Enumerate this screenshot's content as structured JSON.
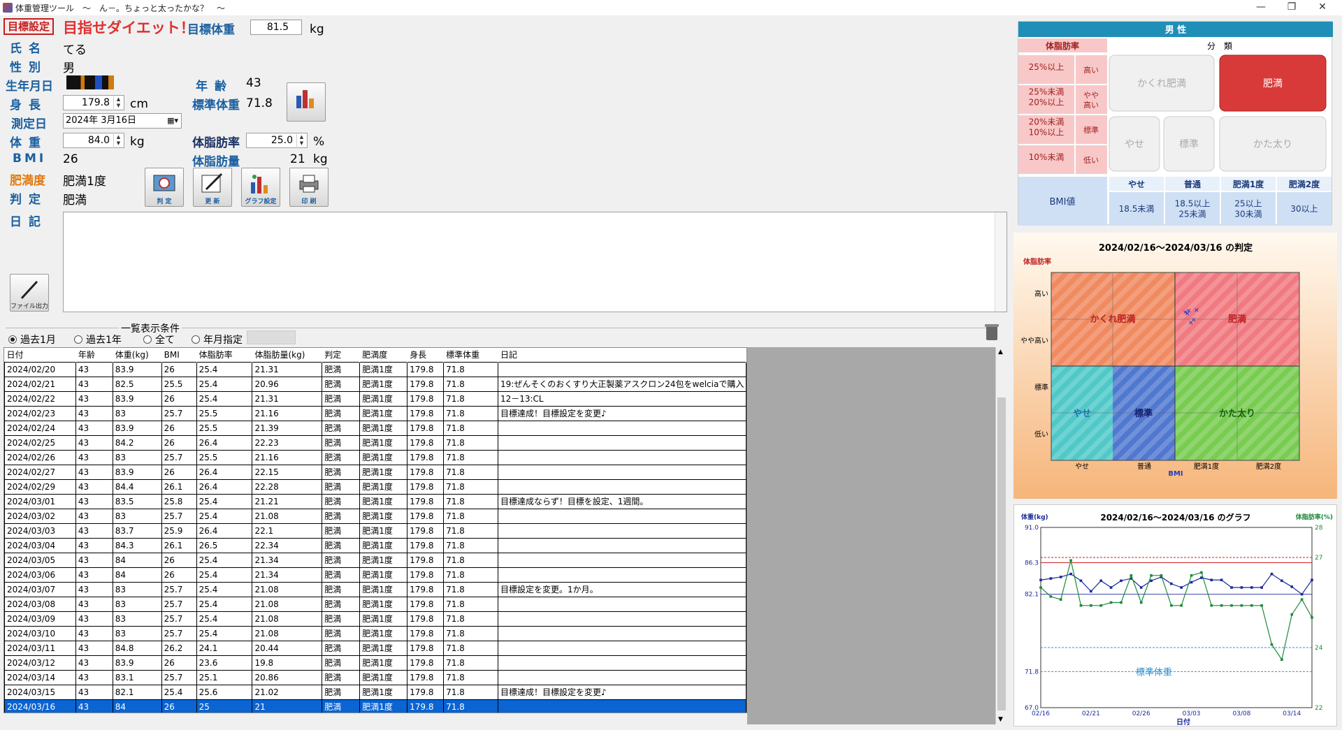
{
  "window": {
    "title": "体重管理ツール　～　ん－。ちょっと太ったかな？　～",
    "min": "—",
    "max": "❐",
    "close": "✕"
  },
  "header": {
    "goal_button": "目標設定",
    "slogan": "目指せダイエット！",
    "goal_weight_label": "目標体重",
    "goal_weight_value": "81.5",
    "goal_weight_unit": "kg"
  },
  "profile": {
    "name_label": "氏名",
    "name_value": "てる",
    "sex_label": "性別",
    "sex_value": "男",
    "birth_label": "生年月日",
    "age_label": "年齢",
    "age_value": "43",
    "height_label": "身長",
    "height_value": "179.8",
    "height_unit": "cm",
    "std_weight_label": "標準体重",
    "std_weight_value": "71.8",
    "date_label": "測定日",
    "date_value": "2024年 3月16日",
    "weight_label": "体重",
    "weight_value": "84.0",
    "weight_unit": "kg",
    "fat_rate_label": "体脂肪率",
    "fat_rate_value": "25.0",
    "fat_rate_unit": "%",
    "bmi_label": "BMI",
    "bmi_value": "26",
    "fat_mass_label": "体脂肪量",
    "fat_mass_value": "21",
    "fat_mass_unit": "kg",
    "obesity_label": "肥満度",
    "obesity_value": "肥満1度",
    "judge_label": "判定",
    "judge_value": "肥満",
    "diary_label": "日記"
  },
  "buttons": {
    "judge": "判 定",
    "update": "更 新",
    "graph_setting": "グラフ設定",
    "print": "印 刷",
    "file_output": "ファイル出力"
  },
  "list_condition": {
    "title": "一覧表示条件",
    "options": [
      "過去1月",
      "過去1年",
      "全て",
      "年月指定"
    ],
    "selected": 0
  },
  "table": {
    "headers": [
      "日付",
      "年齢",
      "体重(kg)",
      "BMI",
      "体脂肪率",
      "体脂肪量(kg)",
      "判定",
      "肥満度",
      "身長",
      "標準体重",
      "日記"
    ],
    "rows": [
      [
        "2024/02/20",
        "43",
        "83.9",
        "26",
        "25.4",
        "21.31",
        "肥満",
        "肥満1度",
        "179.8",
        "71.8",
        ""
      ],
      [
        "2024/02/21",
        "43",
        "82.5",
        "25.5",
        "25.4",
        "20.96",
        "肥満",
        "肥満1度",
        "179.8",
        "71.8",
        "19:ぜんそくのおくすり大正製薬アスクロン24包をwelciaで購入"
      ],
      [
        "2024/02/22",
        "43",
        "83.9",
        "26",
        "25.4",
        "21.31",
        "肥満",
        "肥満1度",
        "179.8",
        "71.8",
        "12－13:CL"
      ],
      [
        "2024/02/23",
        "43",
        "83",
        "25.7",
        "25.5",
        "21.16",
        "肥満",
        "肥満1度",
        "179.8",
        "71.8",
        "目標達成！目標設定を変更♪"
      ],
      [
        "2024/02/24",
        "43",
        "83.9",
        "26",
        "25.5",
        "21.39",
        "肥満",
        "肥満1度",
        "179.8",
        "71.8",
        ""
      ],
      [
        "2024/02/25",
        "43",
        "84.2",
        "26",
        "26.4",
        "22.23",
        "肥満",
        "肥満1度",
        "179.8",
        "71.8",
        ""
      ],
      [
        "2024/02/26",
        "43",
        "83",
        "25.7",
        "25.5",
        "21.16",
        "肥満",
        "肥満1度",
        "179.8",
        "71.8",
        ""
      ],
      [
        "2024/02/27",
        "43",
        "83.9",
        "26",
        "26.4",
        "22.15",
        "肥満",
        "肥満1度",
        "179.8",
        "71.8",
        ""
      ],
      [
        "2024/02/29",
        "43",
        "84.4",
        "26.1",
        "26.4",
        "22.28",
        "肥満",
        "肥満1度",
        "179.8",
        "71.8",
        ""
      ],
      [
        "2024/03/01",
        "43",
        "83.5",
        "25.8",
        "25.4",
        "21.21",
        "肥満",
        "肥満1度",
        "179.8",
        "71.8",
        "目標達成ならず！目標を設定、1週間。"
      ],
      [
        "2024/03/02",
        "43",
        "83",
        "25.7",
        "25.4",
        "21.08",
        "肥満",
        "肥満1度",
        "179.8",
        "71.8",
        ""
      ],
      [
        "2024/03/03",
        "43",
        "83.7",
        "25.9",
        "26.4",
        "22.1",
        "肥満",
        "肥満1度",
        "179.8",
        "71.8",
        ""
      ],
      [
        "2024/03/04",
        "43",
        "84.3",
        "26.1",
        "26.5",
        "22.34",
        "肥満",
        "肥満1度",
        "179.8",
        "71.8",
        ""
      ],
      [
        "2024/03/05",
        "43",
        "84",
        "26",
        "25.4",
        "21.34",
        "肥満",
        "肥満1度",
        "179.8",
        "71.8",
        ""
      ],
      [
        "2024/03/06",
        "43",
        "84",
        "26",
        "25.4",
        "21.34",
        "肥満",
        "肥満1度",
        "179.8",
        "71.8",
        ""
      ],
      [
        "2024/03/07",
        "43",
        "83",
        "25.7",
        "25.4",
        "21.08",
        "肥満",
        "肥満1度",
        "179.8",
        "71.8",
        "目標設定を変更。1か月。"
      ],
      [
        "2024/03/08",
        "43",
        "83",
        "25.7",
        "25.4",
        "21.08",
        "肥満",
        "肥満1度",
        "179.8",
        "71.8",
        ""
      ],
      [
        "2024/03/09",
        "43",
        "83",
        "25.7",
        "25.4",
        "21.08",
        "肥満",
        "肥満1度",
        "179.8",
        "71.8",
        ""
      ],
      [
        "2024/03/10",
        "43",
        "83",
        "25.7",
        "25.4",
        "21.08",
        "肥満",
        "肥満1度",
        "179.8",
        "71.8",
        ""
      ],
      [
        "2024/03/11",
        "43",
        "84.8",
        "26.2",
        "24.1",
        "20.44",
        "肥満",
        "肥満1度",
        "179.8",
        "71.8",
        ""
      ],
      [
        "2024/03/12",
        "43",
        "83.9",
        "26",
        "23.6",
        "19.8",
        "肥満",
        "肥満1度",
        "179.8",
        "71.8",
        ""
      ],
      [
        "2024/03/14",
        "43",
        "83.1",
        "25.7",
        "25.1",
        "20.86",
        "肥満",
        "肥満1度",
        "179.8",
        "71.8",
        ""
      ],
      [
        "2024/03/15",
        "43",
        "82.1",
        "25.4",
        "25.6",
        "21.02",
        "肥満",
        "肥満1度",
        "179.8",
        "71.8",
        "目標達成！目標設定を変更♪"
      ],
      [
        "2024/03/16",
        "43",
        "84",
        "26",
        "25",
        "21",
        "肥満",
        "肥満1度",
        "179.8",
        "71.8",
        ""
      ]
    ],
    "selected_row": 23
  },
  "classification": {
    "title": "男 性",
    "fat_header": "体脂肪率",
    "class_header": "分　類",
    "fat_rows": [
      [
        "25%以上",
        "高い"
      ],
      [
        "25%未満\n20%以上",
        "やや\n高い"
      ],
      [
        "20%未満\n10%以上",
        "標準"
      ],
      [
        "10%未満",
        "低い"
      ]
    ],
    "cells": {
      "hidden_obese": "かくれ肥満",
      "obese": "肥満",
      "thin": "やせ",
      "standard": "標準",
      "solid": "かた太り"
    },
    "bmi_label": "BMI値",
    "bmi_headers": [
      "やせ",
      "普通",
      "肥満1度",
      "肥満2度"
    ],
    "bmi_ranges": [
      "18.5未満",
      "18.5以上\n25未満",
      "25以上\n30未満",
      "30以上"
    ],
    "colors": {
      "header": "#1f8fb8",
      "obese_active": "#d83a3a",
      "pink": "#f8c8c8"
    }
  },
  "judge_chart": {
    "title": "2024/02/16～2024/03/16 の判定",
    "ylabel": "体脂肪率",
    "xlabel": "BMI",
    "yticks": [
      "高い",
      "やや高い",
      "標準",
      "低い"
    ],
    "xticks": [
      "やせ",
      "普通",
      "肥満1度",
      "肥満2度"
    ],
    "regions": {
      "hidden_obese": "かくれ肥満",
      "obese": "肥満",
      "thin": "やせ",
      "standard": "標準",
      "solid": "かた太り"
    },
    "colors": {
      "orange": "#f08a60",
      "red": "#f07a80",
      "cyan": "#50c8c8",
      "blue": "#5078d0",
      "green": "#78cc50"
    }
  },
  "chart_data": {
    "type": "line",
    "title": "2024/02/16～2024/03/16 のグラフ",
    "ylabel": "体重(kg)",
    "y2label": "体脂肪率(%)",
    "xlabel": "日付",
    "xticks": [
      "02/16",
      "02/21",
      "02/26",
      "03/03",
      "03/08",
      "03/14"
    ],
    "ylim": [
      67.0,
      91.0
    ],
    "y2lim": [
      22,
      28
    ],
    "yticks": [
      "91.0",
      "86.3",
      "82.1",
      "71.8",
      "67.0"
    ],
    "y2ticks": [
      "28",
      "27",
      "24",
      "22"
    ],
    "x": [
      "02/16",
      "02/17",
      "02/18",
      "02/19",
      "02/20",
      "02/21",
      "02/22",
      "02/23",
      "02/24",
      "02/25",
      "02/26",
      "02/27",
      "02/29",
      "03/01",
      "03/02",
      "03/03",
      "03/04",
      "03/05",
      "03/06",
      "03/07",
      "03/08",
      "03/09",
      "03/10",
      "03/11",
      "03/12",
      "03/14",
      "03/15",
      "03/16"
    ],
    "series": [
      {
        "name": "体重(kg)",
        "color": "#1a2a9a",
        "values": [
          84.0,
          84.2,
          84.4,
          84.8,
          83.9,
          82.5,
          83.9,
          83.0,
          83.9,
          84.2,
          83.0,
          83.9,
          84.4,
          83.5,
          83.0,
          83.7,
          84.3,
          84.0,
          84.0,
          83.0,
          83.0,
          83.0,
          83.0,
          84.8,
          83.9,
          83.1,
          82.1,
          84.0
        ]
      },
      {
        "name": "体脂肪率(%)",
        "color": "#1e8a3a",
        "values": [
          26.0,
          25.7,
          25.6,
          26.9,
          25.4,
          25.4,
          25.4,
          25.5,
          25.5,
          26.4,
          25.5,
          26.4,
          26.4,
          25.4,
          25.4,
          26.4,
          26.5,
          25.4,
          25.4,
          25.4,
          25.4,
          25.4,
          25.4,
          24.1,
          23.6,
          25.1,
          25.6,
          25.0
        ]
      }
    ],
    "ref_lines": [
      {
        "label": "86.3",
        "value": 86.3,
        "color": "#d02020"
      },
      {
        "label": "標準体重",
        "value": 71.8,
        "color": "#3090d0"
      }
    ],
    "std_weight_label": "標準体重"
  }
}
